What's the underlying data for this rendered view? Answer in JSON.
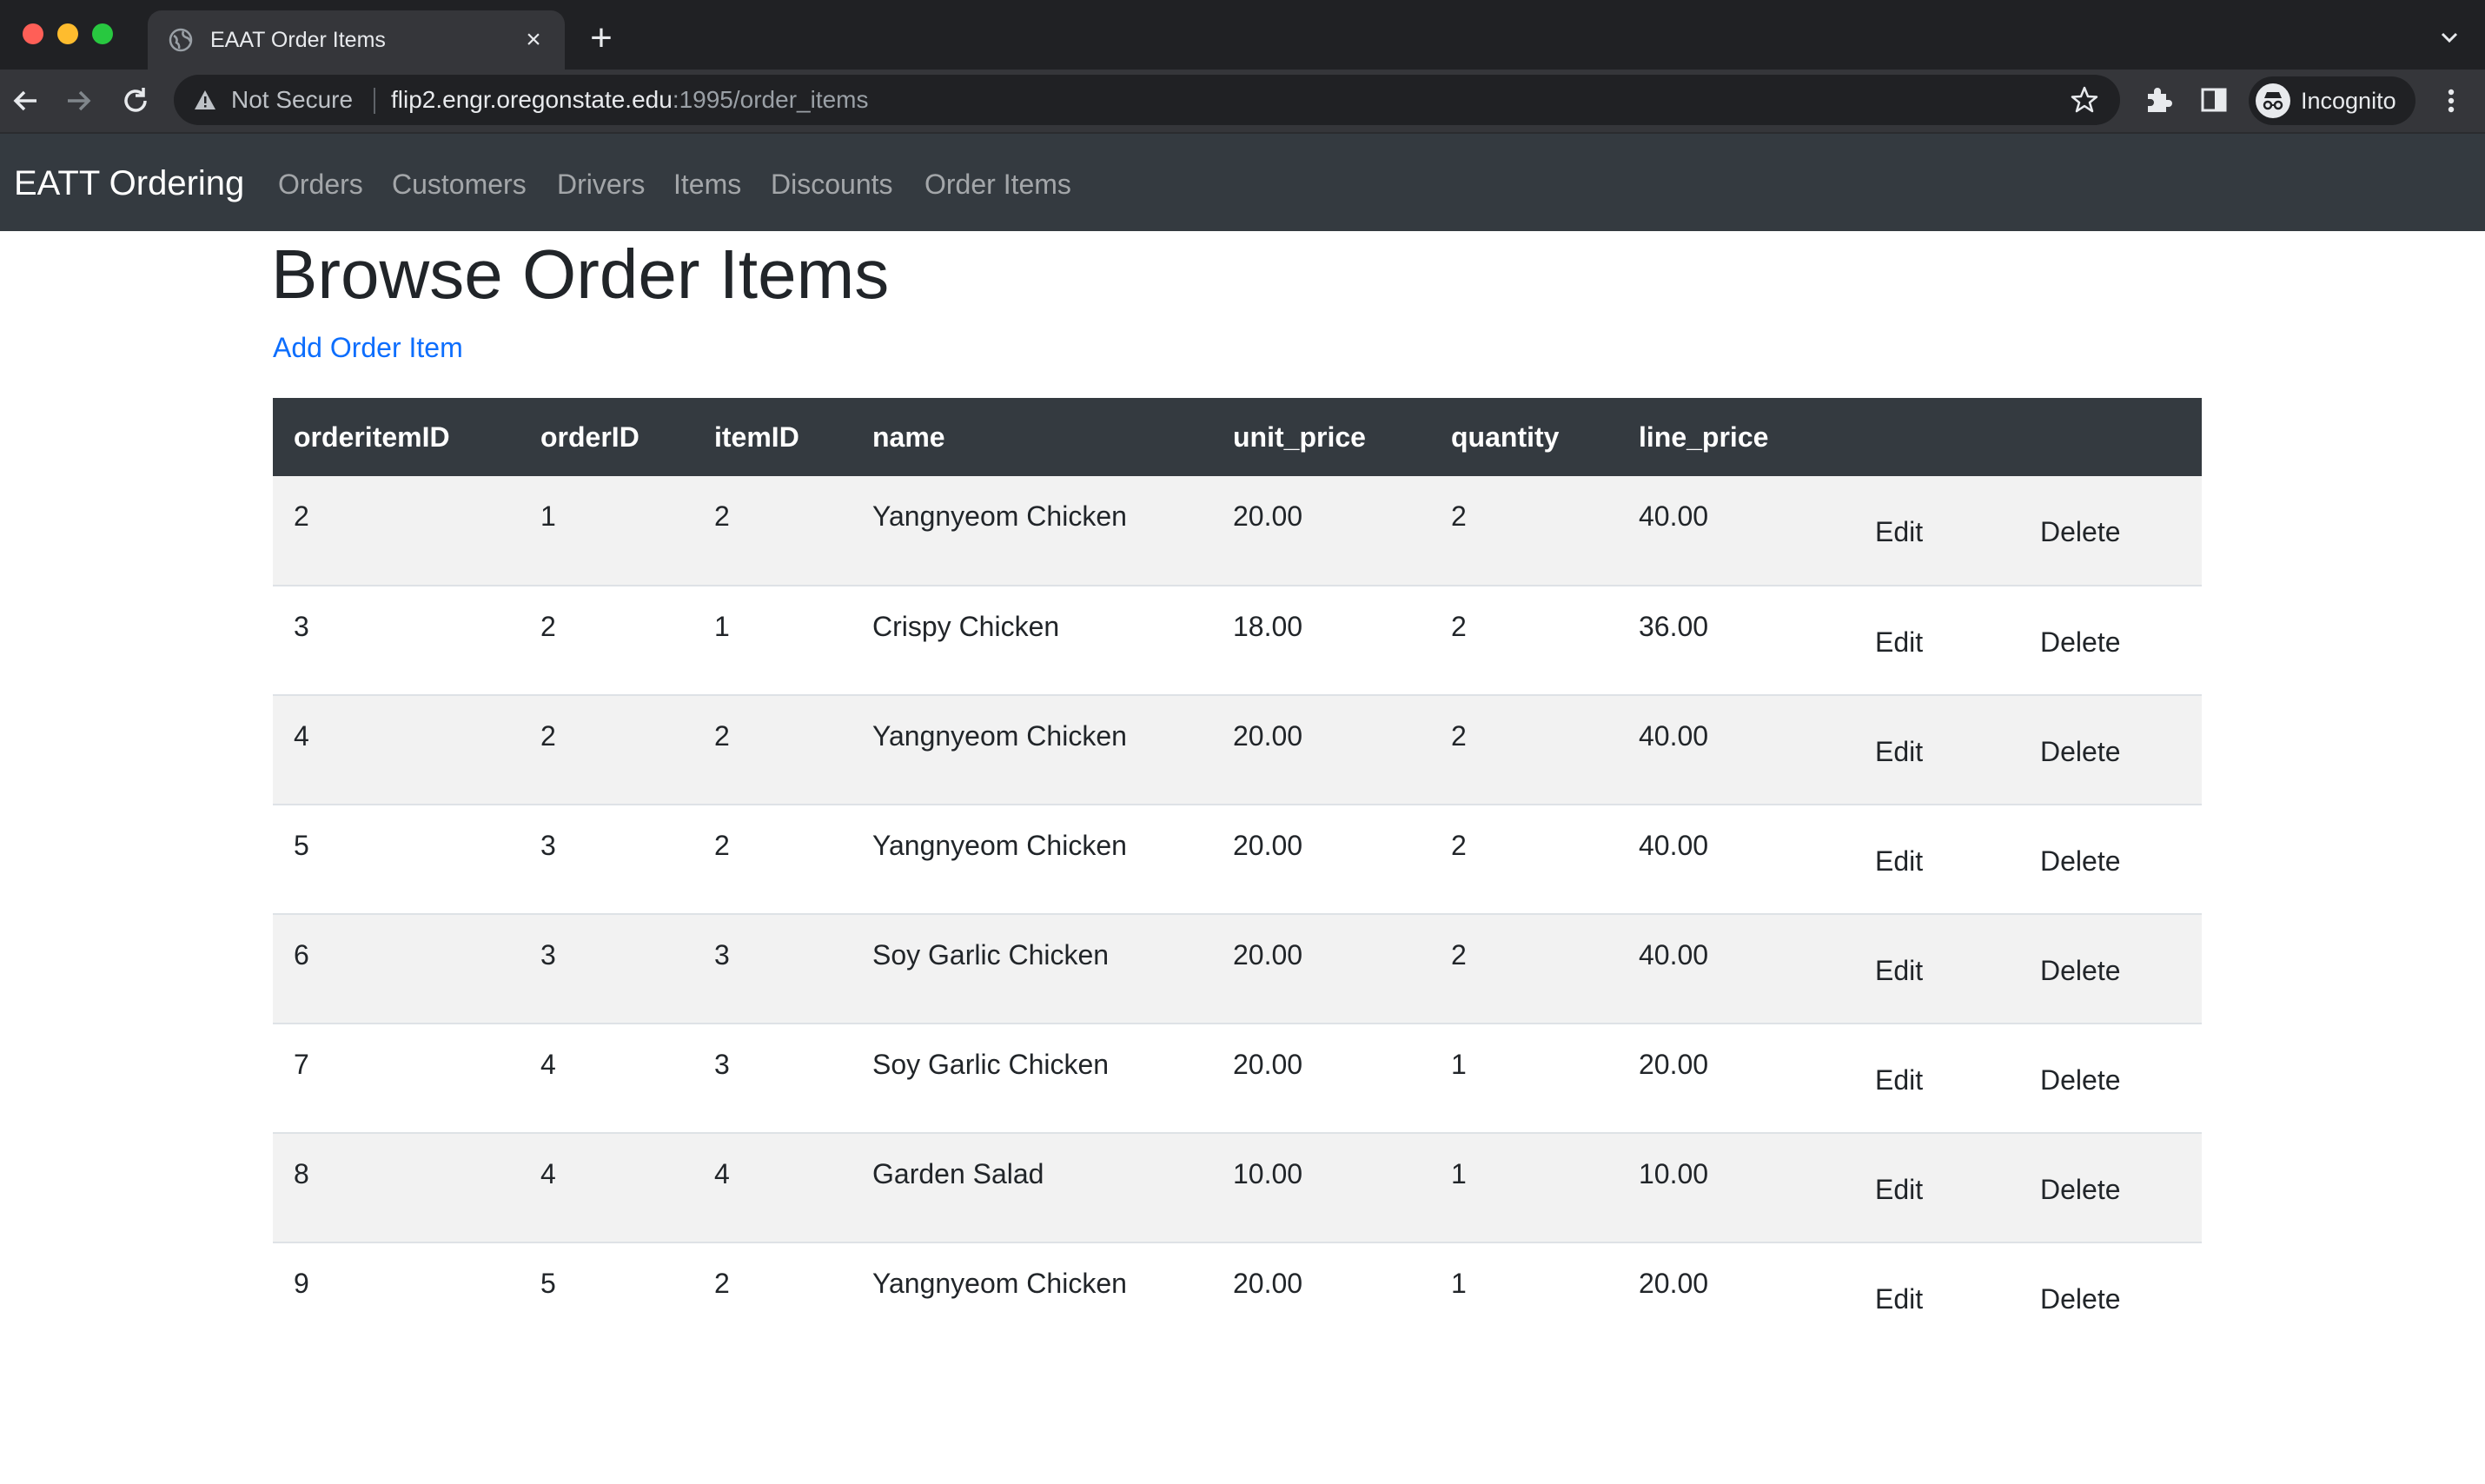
{
  "browser": {
    "tab_title": "EAAT Order Items",
    "tab_close": "×",
    "new_tab": "+",
    "security_label": "Not Secure",
    "url_host": "flip2.engr.oregonstate.edu",
    "url_path": ":1995/order_items",
    "profile_label": "Incognito"
  },
  "navbar": {
    "brand": "EATT Ordering",
    "links": [
      "Orders",
      "Customers",
      "Drivers",
      "Items",
      "Discounts",
      "Order Items"
    ]
  },
  "page": {
    "title": "Browse Order Items",
    "add_link": "Add Order Item"
  },
  "table": {
    "columns": [
      "orderitemID",
      "orderID",
      "itemID",
      "name",
      "unit_price",
      "quantity",
      "line_price",
      "",
      ""
    ],
    "edit_label": "Edit",
    "delete_label": "Delete",
    "rows": [
      [
        "2",
        "1",
        "2",
        "Yangnyeom Chicken",
        "20.00",
        "2",
        "40.00"
      ],
      [
        "3",
        "2",
        "1",
        "Crispy Chicken",
        "18.00",
        "2",
        "36.00"
      ],
      [
        "4",
        "2",
        "2",
        "Yangnyeom Chicken",
        "20.00",
        "2",
        "40.00"
      ],
      [
        "5",
        "3",
        "2",
        "Yangnyeom Chicken",
        "20.00",
        "2",
        "40.00"
      ],
      [
        "6",
        "3",
        "3",
        "Soy Garlic Chicken",
        "20.00",
        "2",
        "40.00"
      ],
      [
        "7",
        "4",
        "3",
        "Soy Garlic Chicken",
        "20.00",
        "1",
        "20.00"
      ],
      [
        "8",
        "4",
        "4",
        "Garden Salad",
        "10.00",
        "1",
        "10.00"
      ],
      [
        "9",
        "5",
        "2",
        "Yangnyeom Chicken",
        "20.00",
        "1",
        "20.00"
      ]
    ]
  }
}
